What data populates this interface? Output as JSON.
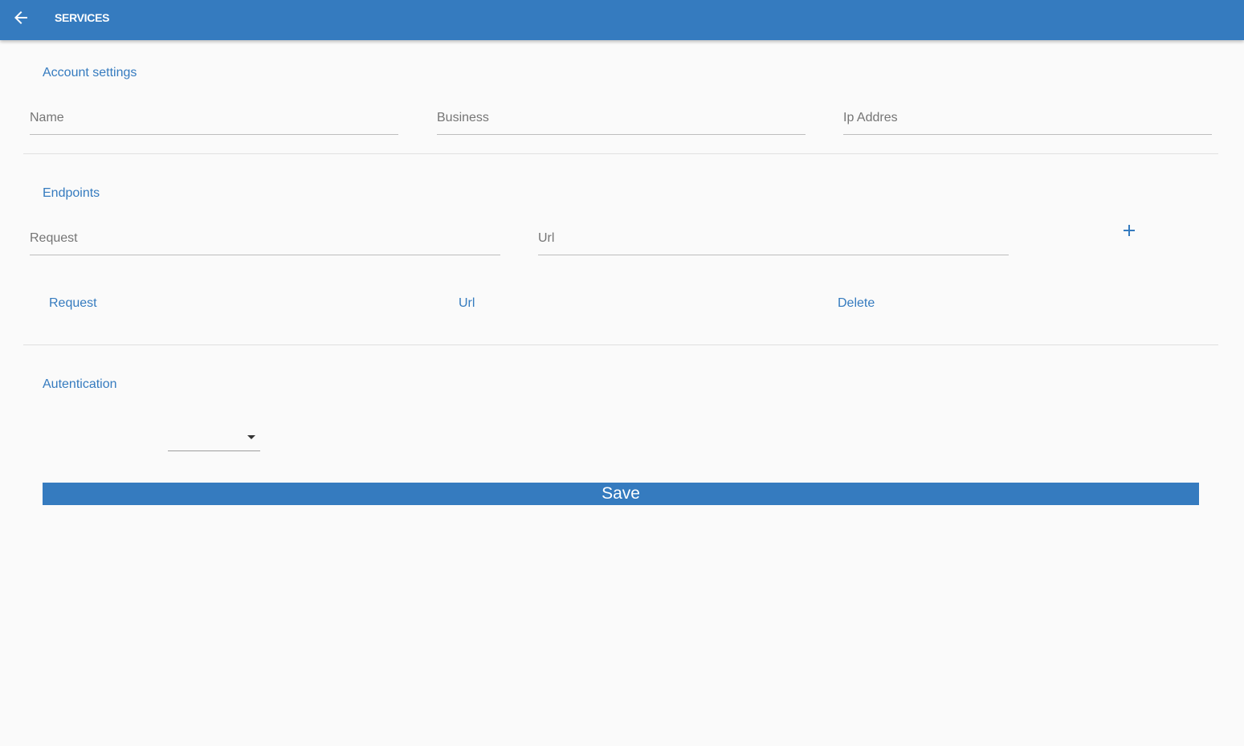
{
  "header": {
    "title": "SERVICES",
    "back_icon": "arrow-left-icon",
    "background": "#357bbf"
  },
  "account_settings": {
    "title": "Account settings",
    "name_placeholder": "Name",
    "name_value": "",
    "business_placeholder": "Business",
    "business_value": "",
    "ip_placeholder": "Ip Addres",
    "ip_value": ""
  },
  "endpoints": {
    "title": "Endpoints",
    "request_placeholder": "Request",
    "request_value": "",
    "url_placeholder": "Url",
    "url_value": "",
    "add_icon": "plus-icon",
    "columns": [
      "Request",
      "Url",
      "Delete"
    ],
    "rows": []
  },
  "authentication": {
    "title": "Autentication",
    "selected": "",
    "arrow_icon": "caret-down-icon"
  },
  "save_label": "Save",
  "colors": {
    "accent": "#357bbf",
    "background": "#fafafa"
  }
}
